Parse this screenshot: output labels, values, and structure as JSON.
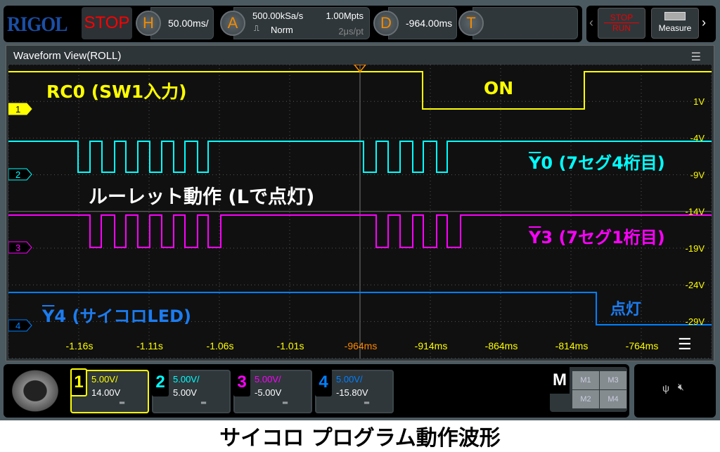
{
  "topbar": {
    "logo": "RIGOL",
    "run_state": "STOP",
    "h_label": "H",
    "timebase": "50.00ms/",
    "a_label": "A",
    "sample_rate": "500.00kSa/s",
    "memory_depth": "1.00Mpts",
    "acq_mode": "Norm",
    "time_per_pt": "2μs/pt",
    "d_label": "D",
    "delay": "-964.00ms",
    "t_label": "T",
    "trigger_value": ""
  },
  "rightbar": {
    "stop_label": "STOP",
    "run_label": "RUN",
    "measure_label": "Measure"
  },
  "window": {
    "title": "Waveform View(ROLL)"
  },
  "annotations": {
    "ch1": "RC0 (SW1入力)",
    "on": "ON",
    "ch2_bar": "Y",
    "ch2": "0 (7セグ4桁目)",
    "roulette": "ルーレット動作 (Lで点灯)",
    "ch3_bar": "Y",
    "ch3": "3 (7セグ1桁目)",
    "ch4_bar": "Y",
    "ch4": "4 (サイコロLED)",
    "lit": "点灯"
  },
  "volt_labels": [
    "1V",
    "-4V",
    "-9V",
    "-14V",
    "-19V",
    "-24V",
    "-29V"
  ],
  "time_labels": [
    "-1.16s",
    "-1.11s",
    "-1.06s",
    "-1.01s",
    "-964ms",
    "-914ms",
    "-864ms",
    "-814ms",
    "-764ms"
  ],
  "channels": [
    {
      "num": "1",
      "scale": "5.00V/",
      "offset": "14.00V",
      "coupling": "DC",
      "color": "#ffff00"
    },
    {
      "num": "2",
      "scale": "5.00V/",
      "offset": "5.00V",
      "coupling": "DC",
      "color": "#00ffff"
    },
    {
      "num": "3",
      "scale": "5.00V/",
      "offset": "-5.00V",
      "coupling": "DC",
      "color": "#ff00ff"
    },
    {
      "num": "4",
      "scale": "5.00V/",
      "offset": "-15.80V",
      "coupling": "DC",
      "color": "#0080ff"
    }
  ],
  "math": {
    "label": "M",
    "items": [
      "M1",
      "M3",
      "M2",
      "M4"
    ]
  },
  "caption": "サイコロ プログラム動作波形"
}
